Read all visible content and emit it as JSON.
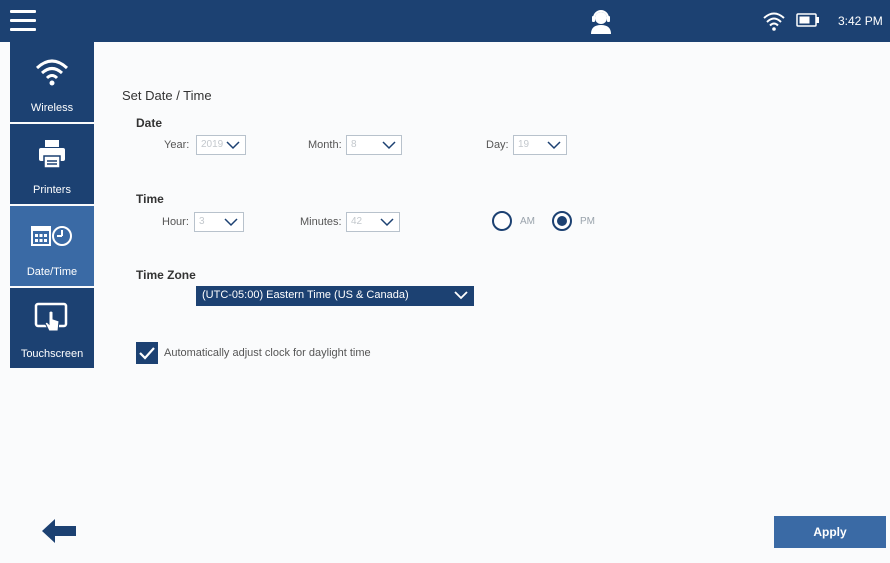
{
  "status_bar": {
    "time": "3:42 PM",
    "icons": [
      "menu-icon",
      "user-headset-icon",
      "wifi-icon",
      "battery-icon"
    ]
  },
  "sidebar": {
    "items": [
      {
        "label": "Wireless",
        "icon": "wifi-icon",
        "active": false
      },
      {
        "label": "Printers",
        "icon": "printer-icon",
        "active": false
      },
      {
        "label": "Date/Time",
        "icon": "calendar-clock-icon",
        "active": true
      },
      {
        "label": "Touchscreen",
        "icon": "touchscreen-icon",
        "active": false
      }
    ]
  },
  "main": {
    "title": "Set Date / Time",
    "date": {
      "label": "Date",
      "year_label": "Year:",
      "year_value": "2019",
      "month_label": "Month:",
      "month_value": "8",
      "day_label": "Day:",
      "day_value": "19"
    },
    "time": {
      "label": "Time",
      "hour_label": "Hour:",
      "hour_value": "3",
      "minutes_label": "Minutes:",
      "minutes_value": "42",
      "am_label": "AM",
      "pm_label": "PM",
      "selected_period": "PM"
    },
    "timezone": {
      "label": "Time Zone",
      "value": "(UTC-05:00) Eastern Time (US & Canada)"
    },
    "dst": {
      "label": "Automatically adjust clock for daylight time",
      "checked": true
    }
  },
  "footer": {
    "apply_label": "Apply"
  },
  "colors": {
    "primary": "#1c4172",
    "active": "#3a6aa5",
    "background": "#fafbfc"
  }
}
